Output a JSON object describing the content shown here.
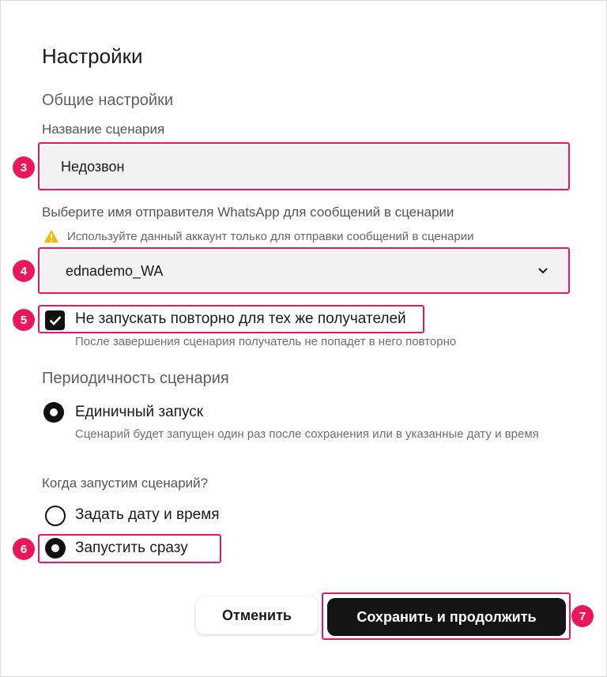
{
  "page": {
    "title": "Настройки"
  },
  "general": {
    "section_title": "Общие настройки",
    "scenario_name_label": "Название сценария",
    "scenario_name_value": "Недозвон",
    "sender_label": "Выберите имя отправителя WhatsApp для сообщений в сценарии",
    "warning_text": "Используйте данный аккаунт только для отправки сообщений в сценарии",
    "sender_value": "ednademo_WA",
    "no_repeat_label": "Не запускать повторно для тех же получателей",
    "no_repeat_checked": true,
    "no_repeat_hint": "После завершения сценария получатель не попадет в него повторно"
  },
  "periodicity": {
    "section_title": "Периодичность сценария",
    "single_run_label": "Единичный запуск",
    "single_run_hint": "Сценарий будет запущен один раз после сохранения или в указанные дату и время",
    "when_label": "Когда запустим сценарий?",
    "option_datetime": "Задать дату и время",
    "option_now": "Запустить сразу"
  },
  "actions": {
    "cancel_label": "Отменить",
    "save_label": "Сохранить и продолжить"
  },
  "annotations": {
    "badge_3": "3",
    "badge_4": "4",
    "badge_5": "5",
    "badge_6": "6",
    "badge_7": "7"
  },
  "colors": {
    "highlight": "#e8185b",
    "primary_button": "#141414",
    "warning": "#f5b800"
  }
}
